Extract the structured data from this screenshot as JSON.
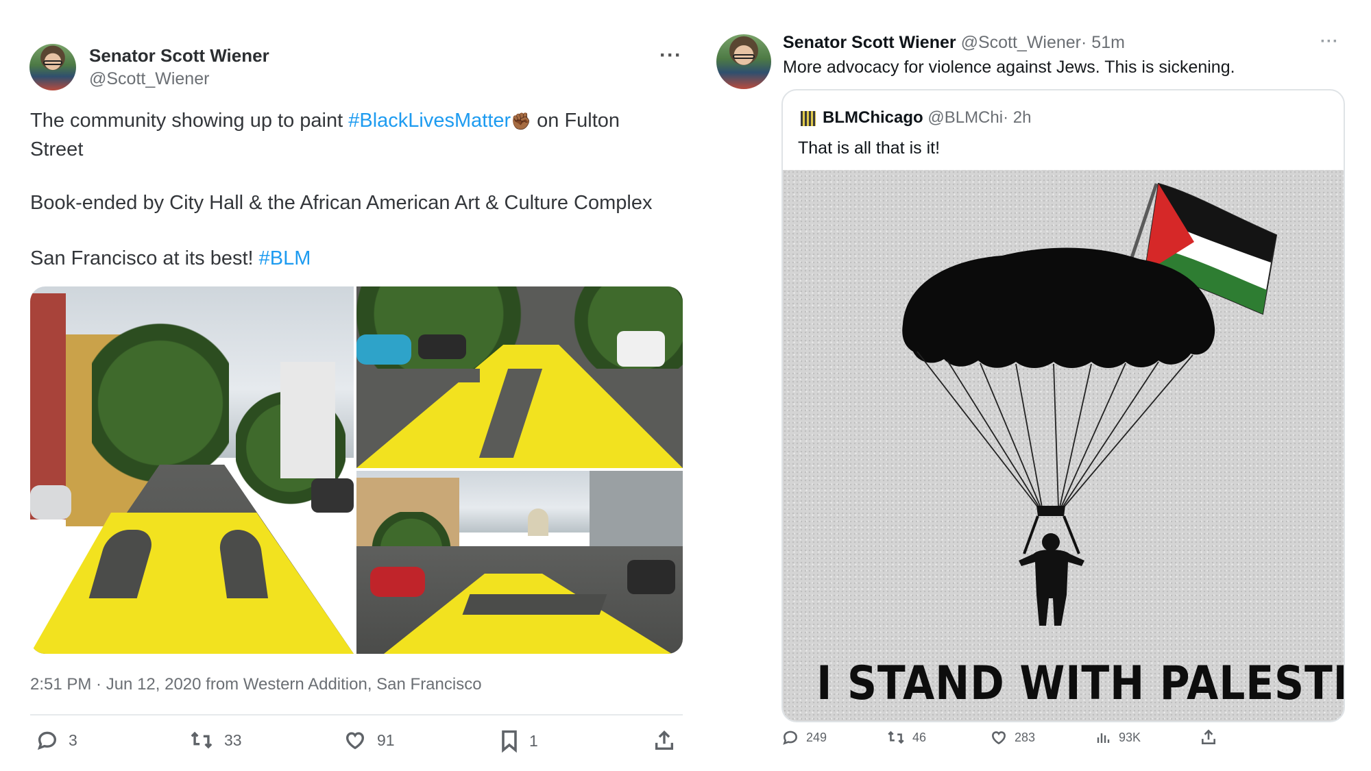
{
  "left_tweet": {
    "author_name": "Senator Scott Wiener",
    "handle": "@Scott_Wiener",
    "more_label": "···",
    "text_line1_pre": "The community showing up to paint ",
    "hashtag_blm_full": "#BlackLivesMatter",
    "emoji": "✊🏾",
    "text_line1_post": " on Fulton",
    "text_line2": "Street",
    "text_para2": "Book-ended by City Hall & the African American Art & Culture Complex",
    "text_para3_pre": "San Francisco at its best! ",
    "hashtag_blm": "#BLM",
    "timestamp": "2:51 PM · Jun 12, 2020 from Western Addition, San Francisco",
    "actions": {
      "replies": "3",
      "retweets": "33",
      "likes": "91",
      "bookmarks": "1"
    }
  },
  "right_tweet": {
    "author_name": "Senator Scott Wiener",
    "handle": "@Scott_Wiener",
    "time": "· 51m",
    "more_label": "···",
    "text": "More advocacy for violence against Jews. This is sickening.",
    "quoted": {
      "author_name": "BLMChicago",
      "handle": "@BLMChi",
      "time": "· 2h",
      "text": "That is all that is it!",
      "poster_text": "I STAND WITH PALESTINE."
    },
    "actions": {
      "replies": "249",
      "retweets": "46",
      "likes": "283",
      "views": "93K"
    }
  },
  "colors": {
    "link": "#1d9bf0",
    "paint_yellow": "#f2e21f",
    "flag_red": "#d62828",
    "flag_green": "#2e7d32"
  }
}
